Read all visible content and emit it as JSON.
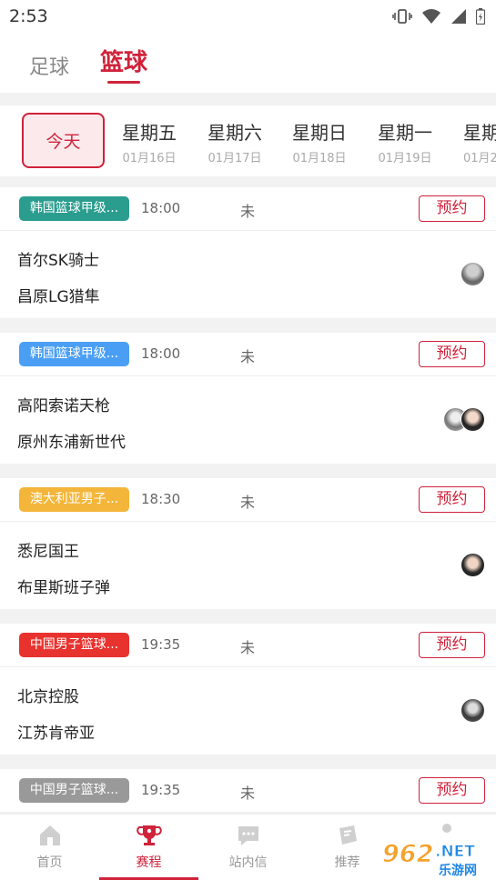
{
  "status_bar": {
    "time": "2:53"
  },
  "sport_tabs": {
    "football": "足球",
    "basketball": "篮球"
  },
  "dates": {
    "today": "今天",
    "days": [
      {
        "weekday": "星期五",
        "date": "01月16日"
      },
      {
        "weekday": "星期六",
        "date": "01月17日"
      },
      {
        "weekday": "星期日",
        "date": "01月18日"
      },
      {
        "weekday": "星期一",
        "date": "01月19日"
      },
      {
        "weekday": "星期",
        "date": "01月2"
      }
    ]
  },
  "reserve_label": "预约",
  "matches": [
    {
      "league": "韩国篮球甲级...",
      "league_color": "#2a9d8f",
      "time": "18:00",
      "status": "未",
      "home": "首尔SK骑士",
      "away": "昌原LG猎隼"
    },
    {
      "league": "韩国篮球甲级...",
      "league_color": "#4a9ff5",
      "time": "18:00",
      "status": "未",
      "home": "高阳索诺天枪",
      "away": "原州东浦新世代"
    },
    {
      "league": "澳大利亚男子...",
      "league_color": "#f4b63a",
      "time": "18:30",
      "status": "未",
      "home": "悉尼国王",
      "away": "布里斯班子弹"
    },
    {
      "league": "中国男子篮球...",
      "league_color": "#e8322e",
      "time": "19:35",
      "status": "未",
      "home": "北京控股",
      "away": "江苏肯帝亚"
    },
    {
      "league": "中国男子篮球...",
      "league_color": "#999999",
      "time": "19:35",
      "status": "未",
      "home": "",
      "away": ""
    }
  ],
  "bottom_nav": [
    {
      "label": "首页",
      "icon": "home-icon"
    },
    {
      "label": "赛程",
      "icon": "trophy-icon"
    },
    {
      "label": "站内信",
      "icon": "message-icon"
    },
    {
      "label": "推荐",
      "icon": "recommend-icon"
    },
    {
      "label": "",
      "icon": "profile-icon"
    }
  ],
  "watermark": {
    "brand": "962.NET",
    "sub": "乐游网"
  },
  "colors": {
    "accent": "#d0223a",
    "background": "#f2f2f2"
  }
}
